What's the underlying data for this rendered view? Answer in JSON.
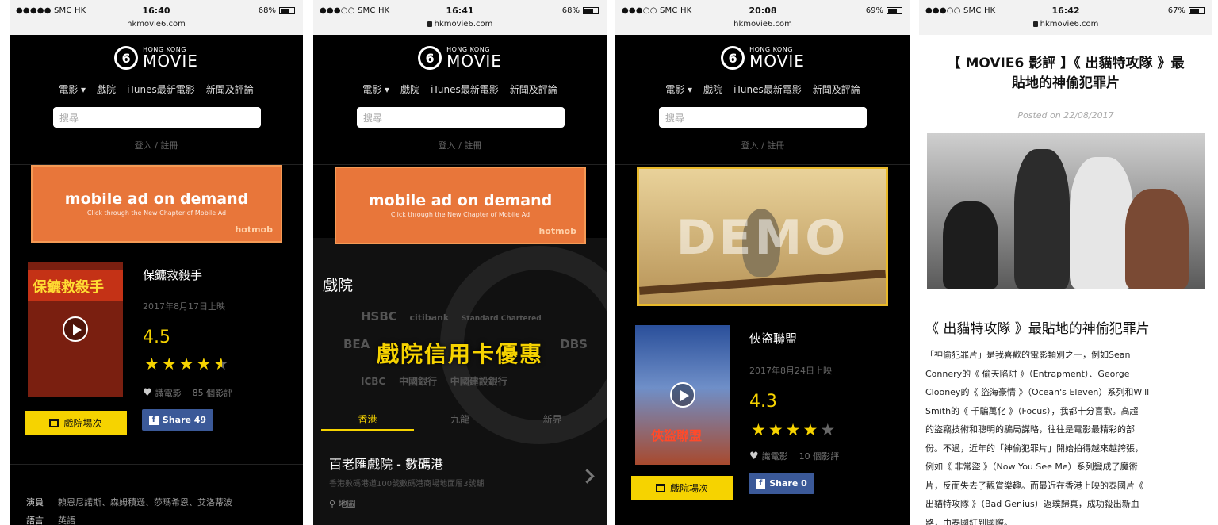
{
  "status_bars": [
    {
      "carrier": "●●●●● SMC HK",
      "time": "16:40",
      "url": "hkmovie6.com",
      "battery": "68%"
    },
    {
      "carrier": "●●●○○ SMC HK",
      "time": "16:41",
      "url": "hkmovie6.com",
      "battery": "68%"
    },
    {
      "carrier": "●●●○○ SMC HK",
      "time": "20:08",
      "url": "hkmovie6.com",
      "battery": "69%"
    },
    {
      "carrier": "●●●○○ SMC HK",
      "time": "16:42",
      "url": "hkmovie6.com",
      "battery": "67%"
    }
  ],
  "site": {
    "logo_small": "HONG KONG",
    "logo_big": "MOVIE",
    "logo_number": "6",
    "nav": [
      "電影 ▾",
      "戲院",
      "iTunes最新電影",
      "新聞及評論"
    ],
    "search_placeholder": "搜尋",
    "login": "登入 / 註冊"
  },
  "ad": {
    "title": "mobile ad on demand",
    "subtitle": "Click through the New Chapter of Mobile Ad",
    "brand": "hotmob"
  },
  "movie1": {
    "poster_title": "保鑣救殺手",
    "title": "保鑣救殺手",
    "date": "2017年8月17日上映",
    "rating": "4.5",
    "stars": 4.5,
    "likes": "識電影",
    "reviews": "85 個影評",
    "showtimes_label": "戲院場次",
    "share_label": "Share 49",
    "cast_label": "演員",
    "cast": "賴恩尼諾斯、森姆積遜、莎瑪希恩、艾洛蒂波",
    "language_label": "語言",
    "language": "英語"
  },
  "cinemas": {
    "heading": "戲院",
    "banks_row1": [
      "HSBC",
      "citibank",
      "Standard Chartered"
    ],
    "banks_row2": [
      "BEA",
      "DBS"
    ],
    "banks_row3": [
      "ICBC",
      "中國銀行",
      "中國建設銀行"
    ],
    "promo": "戲院信用卡優惠",
    "tabs": [
      "香港",
      "九龍",
      "新界"
    ],
    "name": "百老匯戲院 - 數碼港",
    "address": "香港數碼港道100號數碼港商場地面層3號舖",
    "map_label": "地圖"
  },
  "demo_ad": {
    "text": "DEMO"
  },
  "movie2": {
    "poster_title": "俠盜聯盟",
    "title": "俠盜聯盟",
    "date": "2017年8月24日上映",
    "rating": "4.3",
    "stars": 4,
    "likes": "識電影",
    "reviews": "10 個影評",
    "showtimes_label": "戲院場次",
    "share_label": "Share 0"
  },
  "article": {
    "title_line1": "【 MOVIE6 影評 】《 出貓特攻隊 》最",
    "title_line2": "貼地的神偷犯罪片",
    "posted": "Posted on 22/08/2017",
    "heading": "《 出貓特攻隊 》最貼地的神偷犯罪片",
    "body": [
      "「神偷犯罪片」是我喜歡的電影類別之一，例如Sean",
      "Connery的《 偷天陷阱 》（Entrapment）、George",
      "Clooney的《 盜海豪情 》（Ocean's Eleven）系列和Will",
      "Smith的《 千騙萬化 》（Focus），我都十分喜歡。高超",
      "的盜竊技術和聰明的騙局謀略，往往是電影最精彩的部",
      "份。不過，近年的「神偷犯罪片」開始拍得越來越誇張，",
      "例如《 非常盜 》（Now You See Me）系列變成了魔術",
      "片，反而失去了觀賞樂趣。而最近在香港上映的泰國片《",
      "出貓特攻隊 》（Bad Genius）返璞歸真，成功殺出新血",
      "路，由泰國紅到國際。"
    ]
  },
  "colors": {
    "accent": "#f6d300",
    "facebook": "#3b5998",
    "ad_orange": "#e8763a"
  }
}
